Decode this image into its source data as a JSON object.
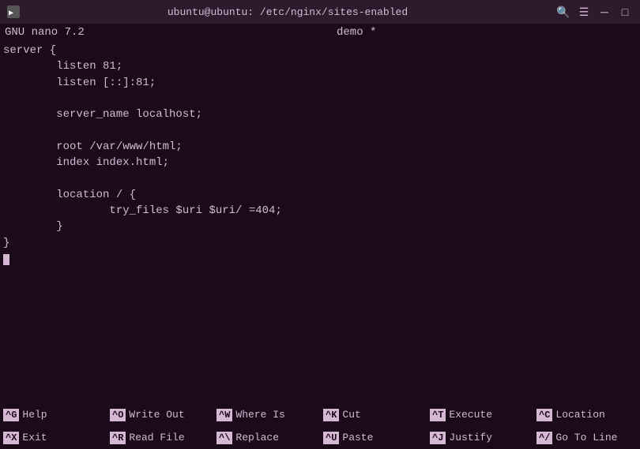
{
  "titlebar": {
    "title": "ubuntu@ubuntu: /etc/nginx/sites-enabled",
    "icon": "terminal"
  },
  "nano": {
    "left_status": "GNU nano 7.2",
    "filename": "demo *"
  },
  "editor": {
    "lines": [
      "server {",
      "        listen 81;",
      "        listen [::]:81;",
      "",
      "        server_name localhost;",
      "",
      "        root /var/www/html;",
      "        index index.html;",
      "",
      "        location / {",
      "                try_files $uri $uri/ =404;",
      "        }",
      "}",
      ""
    ]
  },
  "shortcuts": {
    "row1": [
      {
        "key": "^G",
        "label": "Help"
      },
      {
        "key": "^O",
        "label": "Write Out"
      },
      {
        "key": "^W",
        "label": "Where Is"
      },
      {
        "key": "^K",
        "label": "Cut"
      },
      {
        "key": "^T",
        "label": "Execute"
      },
      {
        "key": "^C",
        "label": "Location"
      }
    ],
    "row2": [
      {
        "key": "^X",
        "label": "Exit"
      },
      {
        "key": "^R",
        "label": "Read File"
      },
      {
        "key": "^\\",
        "label": "Replace"
      },
      {
        "key": "^U",
        "label": "Paste"
      },
      {
        "key": "^J",
        "label": "Justify"
      },
      {
        "key": "^/",
        "label": "Go To Line"
      }
    ]
  }
}
